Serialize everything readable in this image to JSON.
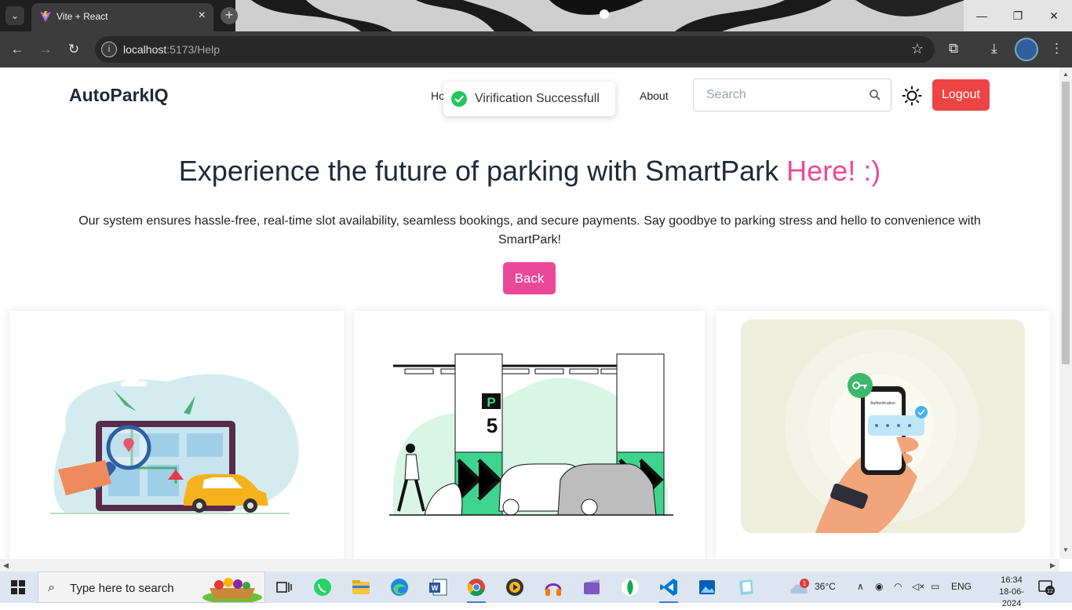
{
  "browser": {
    "tab_title": "Vite + React",
    "url_host": "localhost",
    "url_rest": ":5173/Help"
  },
  "nav": {
    "brand": "AutoParkIQ",
    "home_partial": "Ho",
    "about": "About",
    "search_placeholder": "Search",
    "logout": "Logout"
  },
  "toast": {
    "message": "Virification Successfull"
  },
  "hero": {
    "title_main": "Experience the future of parking with SmartPark ",
    "title_accent": "Here! :)",
    "description": "Our system ensures hassle-free, real-time slot availability, seamless bookings, and secure payments. Say goodbye to parking stress and hello to convenience with SmartPark!",
    "back_button": "Back"
  },
  "cards": {
    "parking_sign_letter": "P",
    "parking_sign_level": "5",
    "auth_phone_label": "Authentication"
  },
  "taskbar": {
    "search_text": "Type here to search",
    "weather_temp": "36°C",
    "weather_badge": "1",
    "language": "ENG",
    "time": "16:34",
    "date": "18-06-2024",
    "notification_count": "12"
  },
  "colors": {
    "accent_pink": "#ec4899",
    "logout_red": "#ef4444",
    "success_green": "#22c55e",
    "parking_green": "#3ed38f"
  }
}
